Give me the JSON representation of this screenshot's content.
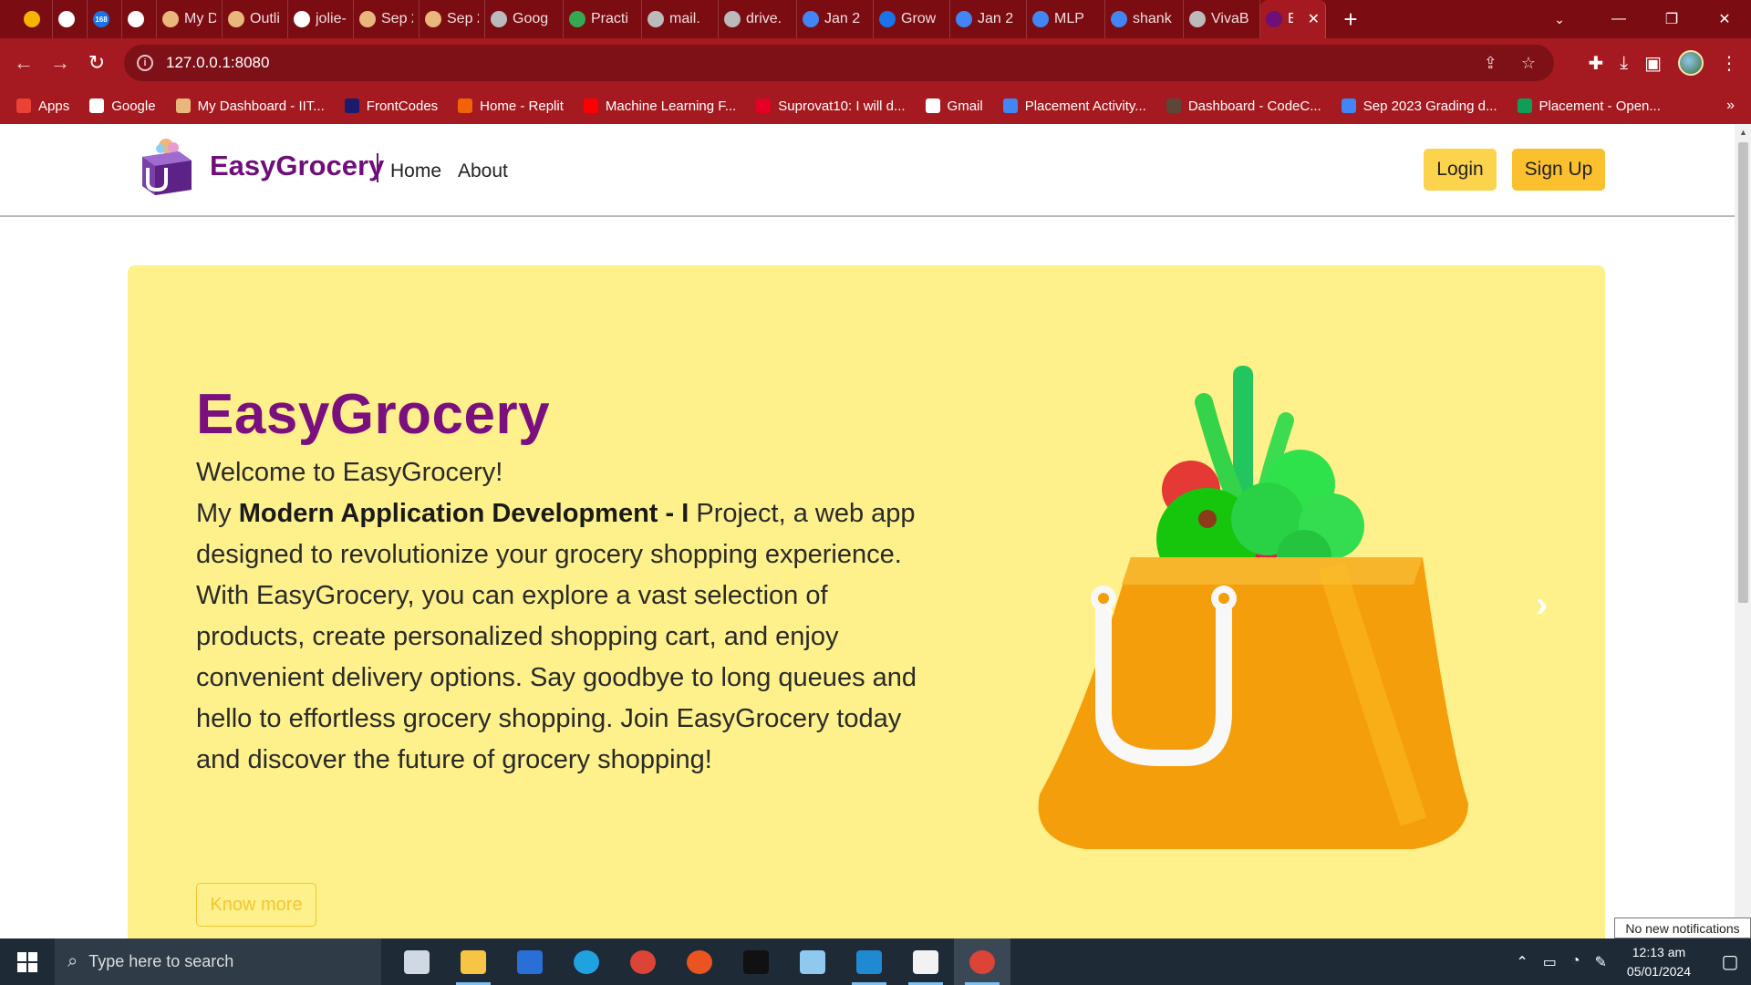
{
  "browser": {
    "tabs": [
      {
        "label": "",
        "icon": "cloud-icon",
        "color": "#f4b400"
      },
      {
        "label": "",
        "icon": "dot-icon",
        "color": "#ffffff"
      },
      {
        "label": "",
        "icon": "badge-icon",
        "badge": "168",
        "color": "#1a73e8"
      },
      {
        "label": "",
        "icon": "calendar-icon",
        "color": "#ffffff"
      },
      {
        "label": "My D",
        "icon": "avatar-icon",
        "color": "#e9b77c"
      },
      {
        "label": "Outli",
        "icon": "avatar-icon",
        "color": "#e9b77c"
      },
      {
        "label": "jolie-",
        "icon": "github-icon",
        "color": "#ffffff"
      },
      {
        "label": "Sep 2",
        "icon": "avatar-icon",
        "color": "#e9b77c"
      },
      {
        "label": "Sep 2",
        "icon": "avatar-icon",
        "color": "#e9b77c"
      },
      {
        "label": "Goog",
        "icon": "globe-icon",
        "color": "#bbbbbb"
      },
      {
        "label": "Practi",
        "icon": "drive-icon",
        "color": "#34a853"
      },
      {
        "label": "mail.",
        "icon": "globe-icon",
        "color": "#bbbbbb"
      },
      {
        "label": "drive.",
        "icon": "drive-icon",
        "color": "#bbbbbb"
      },
      {
        "label": "Jan 2",
        "icon": "docs-icon",
        "color": "#4285f4"
      },
      {
        "label": "Grow",
        "icon": "c-icon",
        "color": "#1a73e8"
      },
      {
        "label": "Jan 2",
        "icon": "docs-icon",
        "color": "#4285f4"
      },
      {
        "label": "MLP",
        "icon": "docs-icon",
        "color": "#4285f4"
      },
      {
        "label": "shank",
        "icon": "docs-icon",
        "color": "#4285f4"
      },
      {
        "label": "VivaB",
        "icon": "globe-icon",
        "color": "#bbbbbb"
      },
      {
        "label": "E",
        "icon": "easygrocery-icon",
        "color": "#6e0f7a",
        "active": true
      }
    ],
    "close_tab": "✕",
    "new_tab": "+",
    "address": "127.0.0.1:8080",
    "bookmarks": [
      {
        "label": "Apps",
        "icon": "apps-grid-icon",
        "color": "#ea4335"
      },
      {
        "label": "Google",
        "icon": "google-icon",
        "color": "#ffffff"
      },
      {
        "label": "My Dashboard - IIT...",
        "icon": "avatar-icon",
        "color": "#e9b77c"
      },
      {
        "label": "FrontCodes",
        "icon": "fc-icon",
        "color": "#1a1a6e"
      },
      {
        "label": "Home - Replit",
        "icon": "replit-icon",
        "color": "#f26207"
      },
      {
        "label": "Machine Learning F...",
        "icon": "youtube-icon",
        "color": "#ff0000"
      },
      {
        "label": "Suprovat10: I will d...",
        "icon": "pinterest-icon",
        "color": "#e60023"
      },
      {
        "label": "Gmail",
        "icon": "google-icon",
        "color": "#ffffff"
      },
      {
        "label": "Placement Activity...",
        "icon": "docs-icon",
        "color": "#4285f4"
      },
      {
        "label": "Dashboard - CodeC...",
        "icon": "codechef-icon",
        "color": "#5b4638"
      },
      {
        "label": "Sep 2023 Grading d...",
        "icon": "docs-icon",
        "color": "#4285f4"
      },
      {
        "label": "Placement - Open...",
        "icon": "sheets-icon",
        "color": "#0f9d58"
      }
    ],
    "bookmarks_more": "»"
  },
  "site": {
    "brand": "EasyGrocery",
    "nav_links": [
      "Home",
      "About"
    ],
    "login": "Login",
    "signup": "Sign Up",
    "accent": "#6e0f7a",
    "hero": {
      "title": "EasyGrocery",
      "welcome": "Welcome to EasyGrocery!",
      "text_prefix": "My ",
      "text_bold": "Modern Application Development - I",
      "text_rest": " Project, a web app designed to revolutionize your grocery shopping experience. With EasyGrocery, you can explore a vast selection of products, create personalized shopping cart, and enjoy convenient delivery options. Say goodbye to long queues and hello to effortless grocery shopping. Join EasyGrocery today and discover the future of grocery shopping!",
      "cta": "Know more",
      "background": "#fef08a",
      "carousel_prev": "‹",
      "carousel_next": "›"
    }
  },
  "os": {
    "search_placeholder": "Type here to search",
    "notification": "No new notifications",
    "time": "12:13 am",
    "date": "05/01/2024",
    "taskbar_apps": [
      {
        "name": "task-view-icon",
        "open": false
      },
      {
        "name": "file-explorer-icon",
        "open": true
      },
      {
        "name": "powershell-icon",
        "open": false
      },
      {
        "name": "edge-icon",
        "open": false
      },
      {
        "name": "chrome-icon",
        "open": false
      },
      {
        "name": "ubuntu-icon",
        "open": false
      },
      {
        "name": "terminal-icon",
        "open": false
      },
      {
        "name": "notepad-icon",
        "open": false
      },
      {
        "name": "vscode-icon",
        "open": true
      },
      {
        "name": "clapper-icon",
        "open": true
      },
      {
        "name": "chrome-active-icon",
        "open": true,
        "active": true
      }
    ]
  }
}
